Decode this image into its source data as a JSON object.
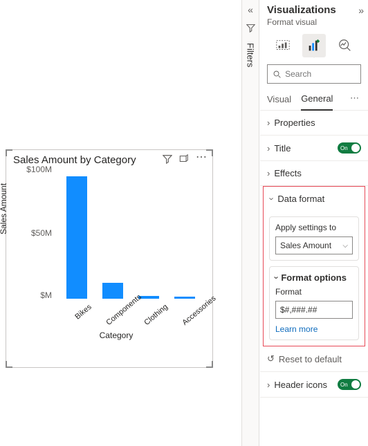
{
  "chart": {
    "title": "Sales Amount by Category",
    "ylabel": "Sales Amount",
    "xlabel": "Category",
    "y_ticks": [
      "$100M",
      "$50M",
      "$M"
    ]
  },
  "chart_data": {
    "type": "bar",
    "title": "Sales Amount by Category",
    "xlabel": "Category",
    "ylabel": "Sales Amount",
    "categories": [
      "Bikes",
      "Components",
      "Clothing",
      "Accessories"
    ],
    "values": [
      94000000,
      12000000,
      2000000,
      1000000
    ],
    "ylim": [
      0,
      100000000
    ],
    "y_format": "$,.0fM"
  },
  "filters": {
    "label": "Filters"
  },
  "viz": {
    "title": "Visualizations",
    "subtitle": "Format visual",
    "search_placeholder": "Search",
    "tabs": {
      "visual": "Visual",
      "general": "General"
    },
    "sections": {
      "properties": "Properties",
      "title": "Title",
      "effects": "Effects",
      "data_format": "Data format",
      "header_icons": "Header icons"
    },
    "toggle_on": "On",
    "apply_settings": {
      "label": "Apply settings to",
      "value": "Sales Amount"
    },
    "format_options": {
      "header": "Format options",
      "format_label": "Format",
      "format_value": "$#,###.##",
      "learn_more": "Learn more"
    },
    "reset": "Reset to default"
  }
}
